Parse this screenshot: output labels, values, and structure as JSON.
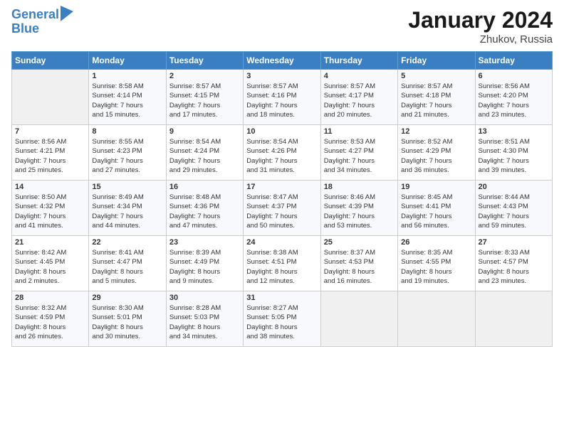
{
  "header": {
    "logo_line1": "General",
    "logo_line2": "Blue",
    "month": "January 2024",
    "location": "Zhukov, Russia"
  },
  "weekdays": [
    "Sunday",
    "Monday",
    "Tuesday",
    "Wednesday",
    "Thursday",
    "Friday",
    "Saturday"
  ],
  "weeks": [
    [
      {
        "day": "",
        "info": ""
      },
      {
        "day": "1",
        "info": "Sunrise: 8:58 AM\nSunset: 4:14 PM\nDaylight: 7 hours\nand 15 minutes."
      },
      {
        "day": "2",
        "info": "Sunrise: 8:57 AM\nSunset: 4:15 PM\nDaylight: 7 hours\nand 17 minutes."
      },
      {
        "day": "3",
        "info": "Sunrise: 8:57 AM\nSunset: 4:16 PM\nDaylight: 7 hours\nand 18 minutes."
      },
      {
        "day": "4",
        "info": "Sunrise: 8:57 AM\nSunset: 4:17 PM\nDaylight: 7 hours\nand 20 minutes."
      },
      {
        "day": "5",
        "info": "Sunrise: 8:57 AM\nSunset: 4:18 PM\nDaylight: 7 hours\nand 21 minutes."
      },
      {
        "day": "6",
        "info": "Sunrise: 8:56 AM\nSunset: 4:20 PM\nDaylight: 7 hours\nand 23 minutes."
      }
    ],
    [
      {
        "day": "7",
        "info": "Sunrise: 8:56 AM\nSunset: 4:21 PM\nDaylight: 7 hours\nand 25 minutes."
      },
      {
        "day": "8",
        "info": "Sunrise: 8:55 AM\nSunset: 4:23 PM\nDaylight: 7 hours\nand 27 minutes."
      },
      {
        "day": "9",
        "info": "Sunrise: 8:54 AM\nSunset: 4:24 PM\nDaylight: 7 hours\nand 29 minutes."
      },
      {
        "day": "10",
        "info": "Sunrise: 8:54 AM\nSunset: 4:26 PM\nDaylight: 7 hours\nand 31 minutes."
      },
      {
        "day": "11",
        "info": "Sunrise: 8:53 AM\nSunset: 4:27 PM\nDaylight: 7 hours\nand 34 minutes."
      },
      {
        "day": "12",
        "info": "Sunrise: 8:52 AM\nSunset: 4:29 PM\nDaylight: 7 hours\nand 36 minutes."
      },
      {
        "day": "13",
        "info": "Sunrise: 8:51 AM\nSunset: 4:30 PM\nDaylight: 7 hours\nand 39 minutes."
      }
    ],
    [
      {
        "day": "14",
        "info": "Sunrise: 8:50 AM\nSunset: 4:32 PM\nDaylight: 7 hours\nand 41 minutes."
      },
      {
        "day": "15",
        "info": "Sunrise: 8:49 AM\nSunset: 4:34 PM\nDaylight: 7 hours\nand 44 minutes."
      },
      {
        "day": "16",
        "info": "Sunrise: 8:48 AM\nSunset: 4:36 PM\nDaylight: 7 hours\nand 47 minutes."
      },
      {
        "day": "17",
        "info": "Sunrise: 8:47 AM\nSunset: 4:37 PM\nDaylight: 7 hours\nand 50 minutes."
      },
      {
        "day": "18",
        "info": "Sunrise: 8:46 AM\nSunset: 4:39 PM\nDaylight: 7 hours\nand 53 minutes."
      },
      {
        "day": "19",
        "info": "Sunrise: 8:45 AM\nSunset: 4:41 PM\nDaylight: 7 hours\nand 56 minutes."
      },
      {
        "day": "20",
        "info": "Sunrise: 8:44 AM\nSunset: 4:43 PM\nDaylight: 7 hours\nand 59 minutes."
      }
    ],
    [
      {
        "day": "21",
        "info": "Sunrise: 8:42 AM\nSunset: 4:45 PM\nDaylight: 8 hours\nand 2 minutes."
      },
      {
        "day": "22",
        "info": "Sunrise: 8:41 AM\nSunset: 4:47 PM\nDaylight: 8 hours\nand 5 minutes."
      },
      {
        "day": "23",
        "info": "Sunrise: 8:39 AM\nSunset: 4:49 PM\nDaylight: 8 hours\nand 9 minutes."
      },
      {
        "day": "24",
        "info": "Sunrise: 8:38 AM\nSunset: 4:51 PM\nDaylight: 8 hours\nand 12 minutes."
      },
      {
        "day": "25",
        "info": "Sunrise: 8:37 AM\nSunset: 4:53 PM\nDaylight: 8 hours\nand 16 minutes."
      },
      {
        "day": "26",
        "info": "Sunrise: 8:35 AM\nSunset: 4:55 PM\nDaylight: 8 hours\nand 19 minutes."
      },
      {
        "day": "27",
        "info": "Sunrise: 8:33 AM\nSunset: 4:57 PM\nDaylight: 8 hours\nand 23 minutes."
      }
    ],
    [
      {
        "day": "28",
        "info": "Sunrise: 8:32 AM\nSunset: 4:59 PM\nDaylight: 8 hours\nand 26 minutes."
      },
      {
        "day": "29",
        "info": "Sunrise: 8:30 AM\nSunset: 5:01 PM\nDaylight: 8 hours\nand 30 minutes."
      },
      {
        "day": "30",
        "info": "Sunrise: 8:28 AM\nSunset: 5:03 PM\nDaylight: 8 hours\nand 34 minutes."
      },
      {
        "day": "31",
        "info": "Sunrise: 8:27 AM\nSunset: 5:05 PM\nDaylight: 8 hours\nand 38 minutes."
      },
      {
        "day": "",
        "info": ""
      },
      {
        "day": "",
        "info": ""
      },
      {
        "day": "",
        "info": ""
      }
    ]
  ]
}
